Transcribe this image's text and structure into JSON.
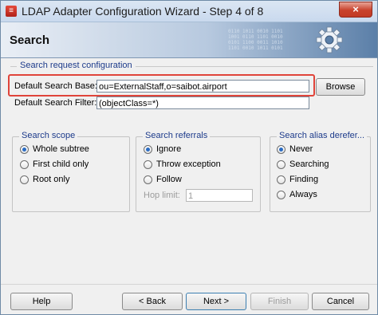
{
  "window": {
    "title": "LDAP Adapter Configuration Wizard - Step 4 of 8",
    "close_glyph": "×",
    "app_icon_glyph": "≡"
  },
  "banner": {
    "title": "Search",
    "binary_text": "0110 1011 0010 1101\n1001 0110 1101 0010\n0101 1100 0011 1010\n1101 0010 1011 0101"
  },
  "section": {
    "title": "Search request configuration"
  },
  "search_base": {
    "label": "Default Search Base:",
    "value": "ou=ExternalStaff,o=saibot.airport",
    "browse_label": "Browse"
  },
  "search_filter": {
    "label": "Default Search Filter:",
    "value": "(objectClass=*)"
  },
  "search_scope": {
    "title": "Search scope",
    "options": [
      {
        "label": "Whole subtree",
        "checked": true
      },
      {
        "label": "First child only",
        "checked": false
      },
      {
        "label": "Root only",
        "checked": false
      }
    ]
  },
  "search_referrals": {
    "title": "Search referrals",
    "options": [
      {
        "label": "Ignore",
        "checked": true
      },
      {
        "label": "Throw exception",
        "checked": false
      },
      {
        "label": "Follow",
        "checked": false
      }
    ],
    "hop_limit_label": "Hop limit:",
    "hop_limit_value": "1"
  },
  "search_alias": {
    "title": "Search alias derefer...",
    "options": [
      {
        "label": "Never",
        "checked": true
      },
      {
        "label": "Searching",
        "checked": false
      },
      {
        "label": "Finding",
        "checked": false
      },
      {
        "label": "Always",
        "checked": false
      }
    ]
  },
  "footer": {
    "help": "Help",
    "back": "< Back",
    "next": "Next >",
    "finish": "Finish",
    "cancel": "Cancel"
  },
  "colors": {
    "highlight": "#e0443a",
    "group_label": "#1d3b8b"
  }
}
